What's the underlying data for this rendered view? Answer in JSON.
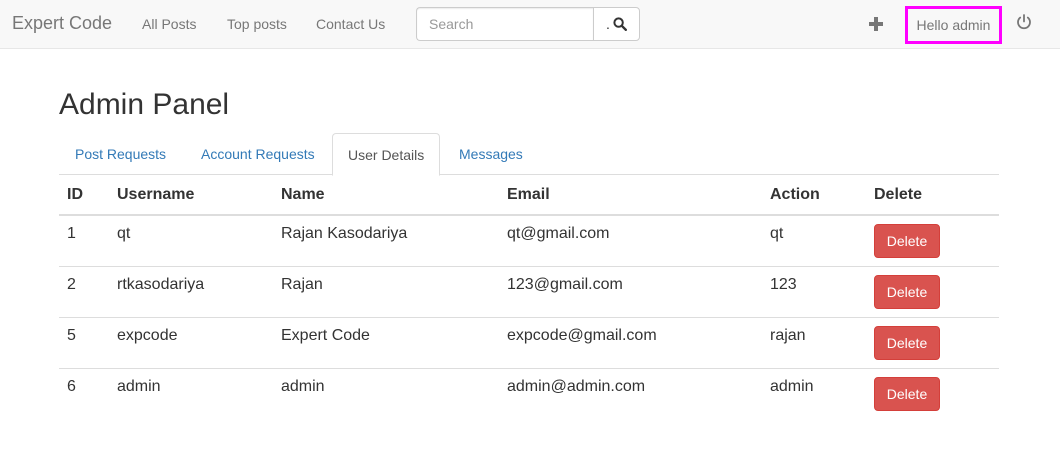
{
  "navbar": {
    "brand": "Expert Code",
    "links": [
      "All Posts",
      "Top posts",
      "Contact Us"
    ],
    "search": {
      "placeholder": "Search",
      "value": "",
      "button_dot": "."
    },
    "greeting": "Hello admin",
    "icons": {
      "add": "plus-icon",
      "logout": "power-icon",
      "search": "search-icon"
    }
  },
  "page": {
    "title": "Admin Panel",
    "tabs": [
      {
        "label": "Post Requests",
        "active": false
      },
      {
        "label": "Account Requests",
        "active": false
      },
      {
        "label": "User Details",
        "active": true
      },
      {
        "label": "Messages",
        "active": false
      }
    ]
  },
  "table": {
    "headers": [
      "ID",
      "Username",
      "Name",
      "Email",
      "Action",
      "Delete"
    ],
    "rows": [
      {
        "id": "1",
        "username": "qt",
        "name": "Rajan Kasodariya",
        "email": "qt@gmail.com",
        "action": "qt",
        "delete_label": "Delete"
      },
      {
        "id": "2",
        "username": "rtkasodariya",
        "name": "Rajan",
        "email": "123@gmail.com",
        "action": "123",
        "delete_label": "Delete"
      },
      {
        "id": "5",
        "username": "expcode",
        "name": "Expert Code",
        "email": "expcode@gmail.com",
        "action": "rajan",
        "delete_label": "Delete"
      },
      {
        "id": "6",
        "username": "admin",
        "name": "admin",
        "email": "admin@admin.com",
        "action": "admin",
        "delete_label": "Delete"
      }
    ]
  },
  "colors": {
    "danger": "#d9534f",
    "link": "#337ab7",
    "highlight": "#ff00ff",
    "navbar_bg": "#f8f8f8"
  }
}
